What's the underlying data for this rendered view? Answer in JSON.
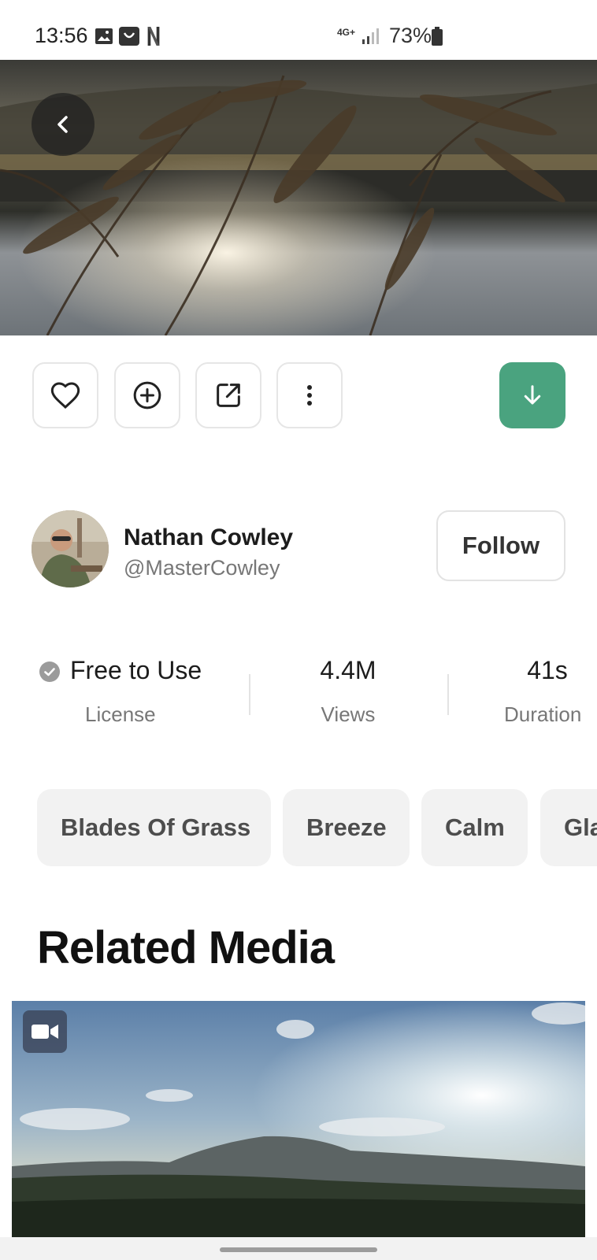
{
  "status_bar": {
    "time": "13:56",
    "network": "4G+",
    "battery": "73%"
  },
  "actions": {
    "like_icon": "heart-icon",
    "add_icon": "plus-circle-icon",
    "share_icon": "external-link-icon",
    "more_icon": "more-vertical-icon",
    "download_icon": "arrow-down-icon",
    "download_color": "#4aa37f"
  },
  "author": {
    "name": "Nathan Cowley",
    "handle": "@MasterCowley",
    "follow_label": "Follow"
  },
  "stats": {
    "license_value": "Free to Use",
    "license_label": "License",
    "views_value": "4.4M",
    "views_label": "Views",
    "duration_value": "41s",
    "duration_label": "Duration"
  },
  "tags": [
    "Blades Of Grass",
    "Breeze",
    "Calm",
    "Gla"
  ],
  "related": {
    "title": "Related Media",
    "badge_icon": "video-camera-icon"
  }
}
